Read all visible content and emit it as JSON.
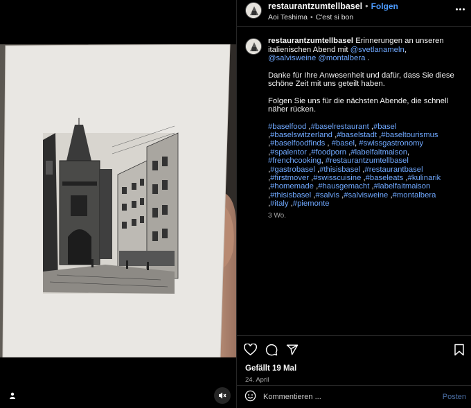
{
  "post": {
    "username": "restaurantzumtellbasel",
    "follow_label": "Folgen",
    "tagged_user": "Aoi Teshima",
    "audio": "C'est si bon",
    "caption": {
      "text_1": "Erinnerungen an unseren italienischen Abend mit",
      "mention_1": "@svetlanameln",
      "mention_2": "@salvisweine",
      "mention_3": "@montalbera",
      "paragraph_2": "Danke für Ihre Anwesenheit und dafür, dass Sie diese schöne Zeit mit uns geteilt haben.",
      "paragraph_3": "Folgen Sie uns für die nächsten Abende, die schnell näher rücken.",
      "hashtags": [
        "#baselfood",
        "#baselrestaurant",
        "#basel",
        "#baselswitzerland",
        "#baselstadt",
        "#baseltourismus",
        "#baselfoodfinds",
        "#basel",
        "#swissgastronomy",
        "#spalentor",
        "#foodporn",
        "#labelfaitmaison",
        "#frenchcooking",
        "#restaurantzumtellbasel",
        "#gastrobasel",
        "#thisisbasel",
        "#restaurantbasel",
        "#firstmover",
        "#swisscuisine",
        "#baseleats",
        "#kulinarik",
        "#homemade",
        "#hausgemacht",
        "#labelfaitmaison",
        "#thisisbasel",
        "#salvis",
        "#salvisweine",
        "#montalbera",
        "#italy",
        "#piemonte"
      ],
      "age": "3 Wo."
    },
    "likes": "Gefällt 19 Mal",
    "date": "24. April",
    "comment_placeholder": "Kommentieren ...",
    "post_button": "Posten"
  },
  "icons": {
    "like": "heart-icon",
    "comment": "comment-icon",
    "share": "paper-plane-icon",
    "save": "bookmark-icon",
    "emoji": "emoji-icon",
    "more": "more-icon",
    "user": "user-tag-icon",
    "mute": "speaker-muted-icon"
  },
  "colors": {
    "background": "#000000",
    "link": "#6fa8ff",
    "follow": "#4c9bff",
    "post_button": "#4b6fa5"
  }
}
